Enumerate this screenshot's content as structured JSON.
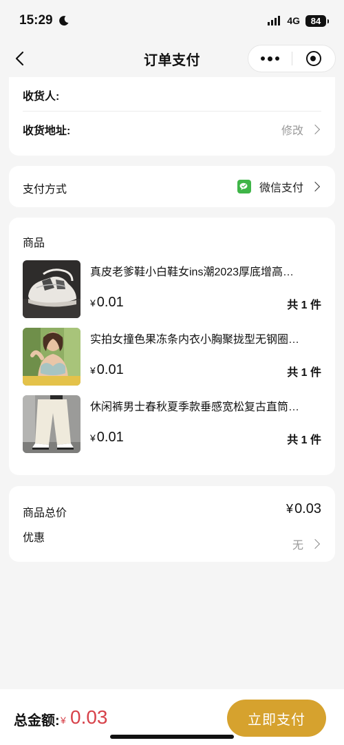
{
  "status_bar": {
    "time": "15:29",
    "network": "4G",
    "battery": "84"
  },
  "nav": {
    "title": "订单支付"
  },
  "address_card": {
    "receiver_label": "收货人:",
    "address_label": "收货地址:",
    "modify_label": "修改"
  },
  "payment": {
    "label": "支付方式",
    "method": "微信支付"
  },
  "goods": {
    "title": "商品",
    "items": [
      {
        "name": "真皮老爹鞋小白鞋女ins潮2023厚底增高…",
        "currency": "¥",
        "price": "0.01",
        "quantity": "共 1 件"
      },
      {
        "name": "实拍女撞色果冻条内衣小胸聚拢型无钢圈…",
        "currency": "¥",
        "price": "0.01",
        "quantity": "共 1 件"
      },
      {
        "name": "休闲裤男士春秋夏季款垂感宽松复古直筒…",
        "currency": "¥",
        "price": "0.01",
        "quantity": "共 1 件"
      }
    ]
  },
  "summary": {
    "total_label": "商品总价",
    "currency": "¥",
    "total_value": "0.03",
    "discount_label": "优惠",
    "discount_value": "无"
  },
  "bottom": {
    "total_label": "总金额:",
    "currency": "¥",
    "total_amount": "0.03",
    "pay_button": "立即支付"
  },
  "colors": {
    "accent": "#d6a22e",
    "price_red": "#d7424a",
    "wechat_green": "#3fb548",
    "background": "#f5f5f5"
  }
}
